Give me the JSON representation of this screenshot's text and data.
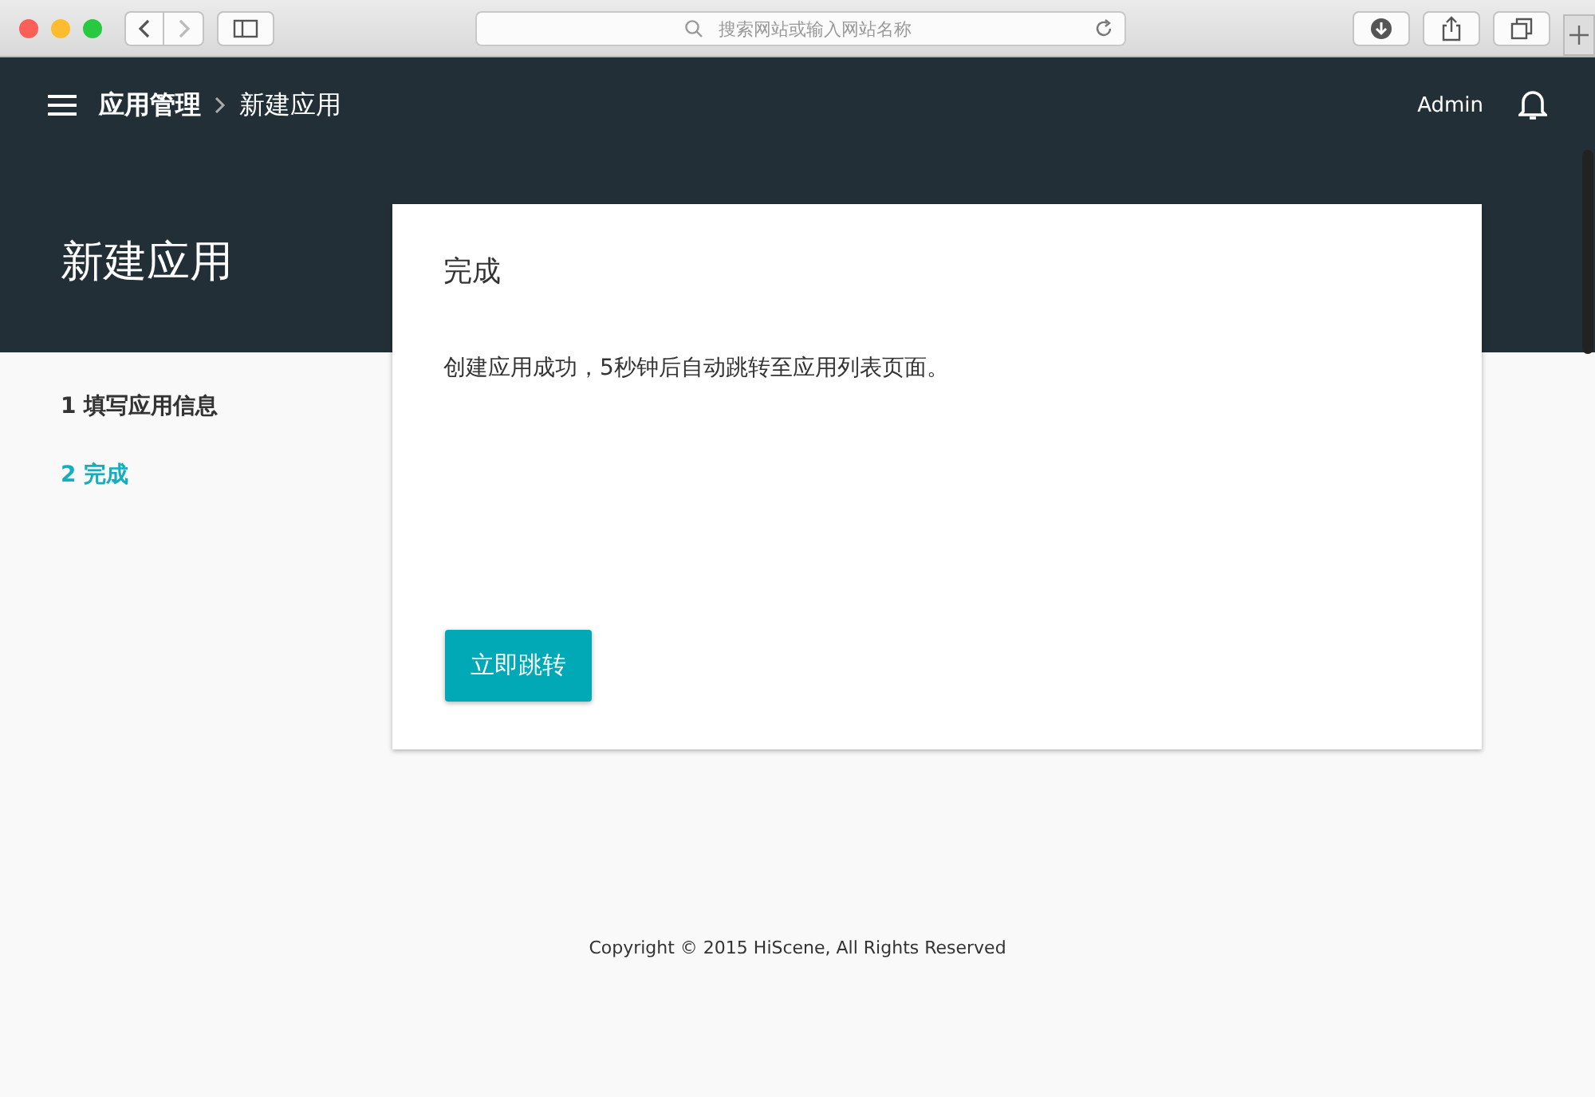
{
  "browser": {
    "address_bar": {
      "placeholder": "搜索网站或输入网站名称"
    }
  },
  "header": {
    "breadcrumb": [
      "应用管理",
      "新建应用"
    ],
    "user": "Admin"
  },
  "page_title": "新建应用",
  "steps": [
    {
      "label": "1 填写应用信息",
      "selected": false
    },
    {
      "label": "2 完成",
      "selected": true
    }
  ],
  "card": {
    "title": "完成",
    "message": "创建应用成功，5秒钟后自动跳转至应用列表页面。",
    "button": "立即跳转"
  },
  "footer": "Copyright © 2015 HiScene, All Rights Reserved"
}
